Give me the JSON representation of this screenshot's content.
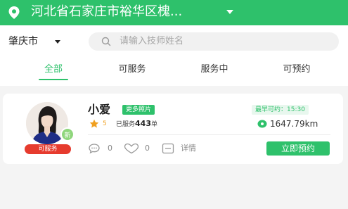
{
  "colors": {
    "accent": "#2ec16b",
    "status_red": "#e63b2e",
    "star": "#f0a020"
  },
  "header": {
    "location": "河北省石家庄市裕华区槐...",
    "location_icon": "location-pin-icon",
    "dropdown_icon": "chevron-down-icon"
  },
  "search": {
    "city": "肇庆市",
    "placeholder": "请输入技师姓名",
    "icon": "search-icon"
  },
  "tabs": [
    {
      "label": "全部",
      "active": true
    },
    {
      "label": "可服务",
      "active": false
    },
    {
      "label": "服务中",
      "active": false
    },
    {
      "label": "可预约",
      "active": false
    }
  ],
  "therapist": {
    "name": "小爱",
    "more_photos": "更多照片",
    "earliest": "最早可约：15:30",
    "rating": "5",
    "served_prefix": "已服务",
    "served_count": "443",
    "served_suffix": "单",
    "distance": "1647.79km",
    "new_badge": "新",
    "status": "可服务",
    "comments": "0",
    "likes": "0",
    "details": "详情",
    "book": "立即预约"
  }
}
